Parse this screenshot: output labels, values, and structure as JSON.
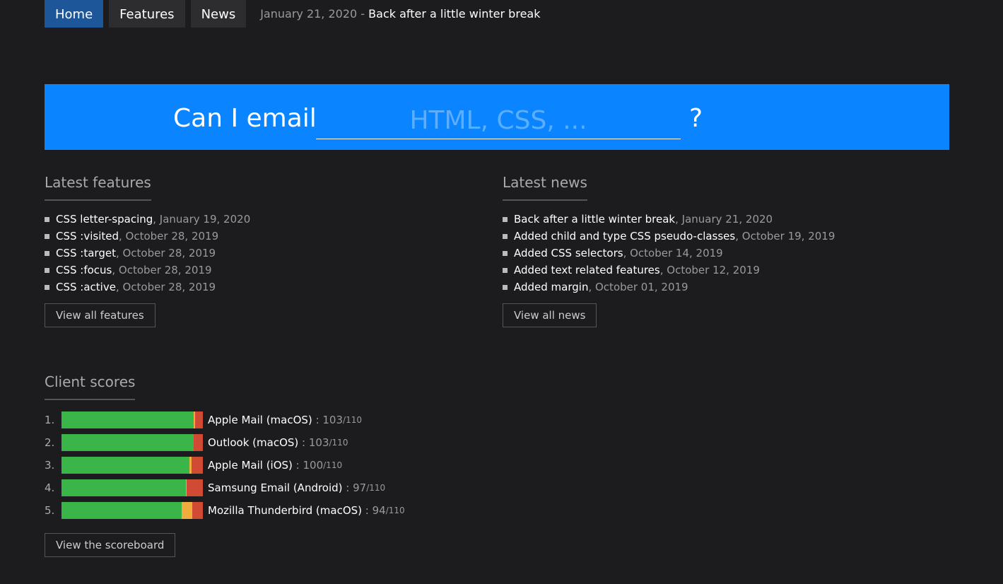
{
  "nav": {
    "items": [
      {
        "label": "Home",
        "active": true
      },
      {
        "label": "Features"
      },
      {
        "label": "News"
      }
    ],
    "ticker_date": "January 21, 2020",
    "ticker_sep": " - ",
    "ticker_title": "Back after a little winter break"
  },
  "hero": {
    "label": "Can I email",
    "placeholder": "HTML, CSS, ...",
    "suffix": "?",
    "color": "#0a84ff"
  },
  "features": {
    "title": "Latest features",
    "items": [
      {
        "name": "CSS letter-spacing",
        "date": ", January 19, 2020"
      },
      {
        "name": "CSS :visited",
        "date": ", October 28, 2019"
      },
      {
        "name": "CSS :target",
        "date": ", October 28, 2019"
      },
      {
        "name": "CSS :focus",
        "date": ", October 28, 2019"
      },
      {
        "name": "CSS :active",
        "date": ", October 28, 2019"
      }
    ],
    "button": "View all features"
  },
  "news": {
    "title": "Latest news",
    "items": [
      {
        "name": "Back after a little winter break",
        "date": ", January 21, 2020"
      },
      {
        "name": "Added child and type CSS pseudo-classes",
        "date": ", October 19, 2019"
      },
      {
        "name": "Added CSS selectors",
        "date": ", October 14, 2019"
      },
      {
        "name": "Added text related features",
        "date": ", October 12, 2019"
      },
      {
        "name": "Added margin",
        "date": ", October 01, 2019"
      }
    ],
    "button": "View all news"
  },
  "scores": {
    "title": "Client scores",
    "button": "View the scoreboard",
    "colors": {
      "supported": "#3ab54a",
      "partial": "#f0ad3e",
      "unsupported": "#d04a34"
    },
    "items": [
      {
        "rank": "1.",
        "name": "Apple Mail (macOS)",
        "score": "103",
        "total": "/110",
        "supported_pct": 93.5,
        "partial_pct": 1,
        "unsupported_pct": 5.5
      },
      {
        "rank": "2.",
        "name": "Outlook (macOS)",
        "score": "103",
        "total": "/110",
        "supported_pct": 93.5,
        "partial_pct": 0,
        "unsupported_pct": 6.5
      },
      {
        "rank": "3.",
        "name": "Apple Mail (iOS)",
        "score": "100",
        "total": "/110",
        "supported_pct": 90.5,
        "partial_pct": 1.5,
        "unsupported_pct": 8
      },
      {
        "rank": "4.",
        "name": "Samsung Email (Android)",
        "score": "97",
        "total": "/110",
        "supported_pct": 88,
        "partial_pct": 0.5,
        "unsupported_pct": 11.5
      },
      {
        "rank": "5.",
        "name": "Mozilla Thunderbird (macOS)",
        "score": "94",
        "total": "/110",
        "supported_pct": 85,
        "partial_pct": 7.5,
        "unsupported_pct": 7.5
      }
    ]
  }
}
